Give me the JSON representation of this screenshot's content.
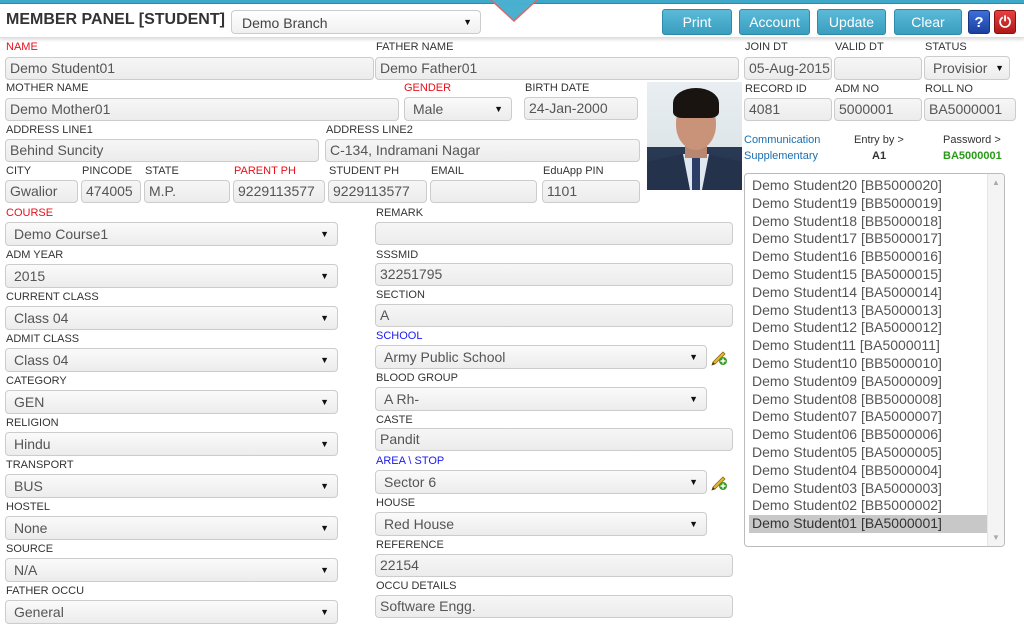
{
  "header": {
    "title": "MEMBER PANEL [STUDENT]",
    "branch": "Demo Branch",
    "buttons": {
      "print": "Print",
      "account": "Account",
      "update": "Update",
      "clear": "Clear"
    },
    "help_icon": "?",
    "power_icon": "⏻"
  },
  "fields": {
    "name": {
      "label": "NAME",
      "value": "Demo Student01"
    },
    "father_name": {
      "label": "FATHER NAME",
      "value": "Demo Father01"
    },
    "join_dt": {
      "label": "JOIN DT",
      "value": "05-Aug-2015"
    },
    "valid_dt": {
      "label": "VALID DT",
      "value": ""
    },
    "status": {
      "label": "STATUS",
      "value": "Provisior"
    },
    "mother_name": {
      "label": "MOTHER NAME",
      "value": "Demo Mother01"
    },
    "gender": {
      "label": "GENDER",
      "value": "Male"
    },
    "birth_date": {
      "label": "BIRTH DATE",
      "value": "24-Jan-2000"
    },
    "record_id": {
      "label": "RECORD ID",
      "value": "4081"
    },
    "adm_no": {
      "label": "ADM NO",
      "value": "5000001"
    },
    "roll_no": {
      "label": "ROLL NO",
      "value": "BA5000001"
    },
    "address1": {
      "label": "ADDRESS LINE1",
      "value": "Behind Suncity"
    },
    "address2": {
      "label": "ADDRESS LINE2",
      "value": "C-134, Indramani Nagar"
    },
    "city": {
      "label": "CITY",
      "value": "Gwalior"
    },
    "pincode": {
      "label": "PINCODE",
      "value": "474005"
    },
    "state": {
      "label": "STATE",
      "value": "M.P."
    },
    "parent_ph": {
      "label": "PARENT PH",
      "value": "9229113577"
    },
    "student_ph": {
      "label": "STUDENT PH",
      "value": "9229113577"
    },
    "email": {
      "label": "EMAIL",
      "value": ""
    },
    "eduapp_pin": {
      "label": "EduApp PIN",
      "value": "1101"
    },
    "course": {
      "label": "COURSE",
      "value": "Demo Course1"
    },
    "adm_year": {
      "label": "ADM YEAR",
      "value": "2015"
    },
    "current_class": {
      "label": "CURRENT CLASS",
      "value": "Class 04"
    },
    "admit_class": {
      "label": "ADMIT CLASS",
      "value": "Class 04"
    },
    "category": {
      "label": "CATEGORY",
      "value": "GEN"
    },
    "religion": {
      "label": "RELIGION",
      "value": "Hindu"
    },
    "transport": {
      "label": "TRANSPORT",
      "value": "BUS"
    },
    "hostel": {
      "label": "HOSTEL",
      "value": "None"
    },
    "source": {
      "label": "SOURCE",
      "value": "N/A"
    },
    "father_occu": {
      "label": "FATHER OCCU",
      "value": "General"
    },
    "remark": {
      "label": "REMARK",
      "value": ""
    },
    "sssmid": {
      "label": "SSSMID",
      "value": "32251795"
    },
    "section": {
      "label": "SECTION",
      "value": "A"
    },
    "school": {
      "label": "SCHOOL",
      "value": "Army Public School"
    },
    "blood_group": {
      "label": "BLOOD GROUP",
      "value": "A Rh-"
    },
    "caste": {
      "label": "CASTE",
      "value": "Pandit"
    },
    "area_stop": {
      "label": "AREA \\ STOP",
      "value": "Sector 6"
    },
    "house": {
      "label": "HOUSE",
      "value": "Red House"
    },
    "reference": {
      "label": "REFERENCE",
      "value": "22154"
    },
    "occu_details": {
      "label": "OCCU DETAILS",
      "value": "Software Engg."
    }
  },
  "links": {
    "communication": "Communication",
    "supplementary": "Supplementary"
  },
  "meta": {
    "entry_by_label": "Entry by >",
    "entry_by_value": "A1",
    "password_label": "Password >",
    "password_value": "BA5000001"
  },
  "students": [
    "Demo Student20 [BB5000020]",
    "Demo Student19 [BB5000019]",
    "Demo Student18 [BB5000018]",
    "Demo Student17 [BB5000017]",
    "Demo Student16 [BB5000016]",
    "Demo Student15 [BA5000015]",
    "Demo Student14 [BA5000014]",
    "Demo Student13 [BA5000013]",
    "Demo Student12 [BA5000012]",
    "Demo Student11 [BA5000011]",
    "Demo Student10 [BB5000010]",
    "Demo Student09 [BA5000009]",
    "Demo Student08 [BB5000008]",
    "Demo Student07 [BA5000007]",
    "Demo Student06 [BB5000006]",
    "Demo Student05 [BA5000005]",
    "Demo Student04 [BB5000004]",
    "Demo Student03 [BA5000003]",
    "Demo Student02 [BB5000002]",
    "Demo Student01 [BA5000001]"
  ],
  "selected_student_index": 19
}
